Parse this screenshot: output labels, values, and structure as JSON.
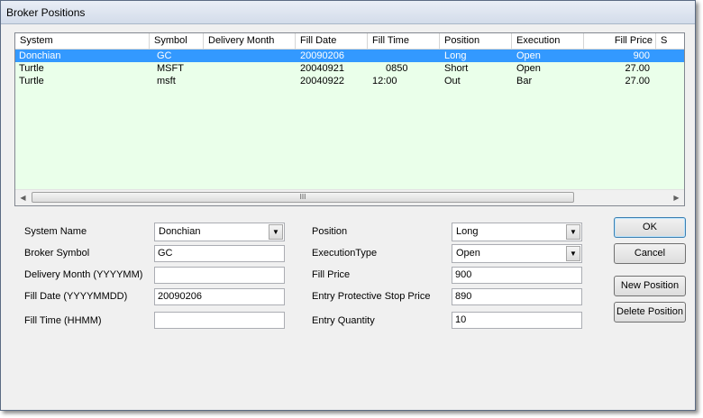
{
  "window": {
    "title": "Broker Positions"
  },
  "list": {
    "columns": [
      "System",
      "Symbol",
      "Delivery Month",
      "Fill Date",
      "Fill Time",
      "Position",
      "Execution",
      "Fill Price",
      "S"
    ],
    "rows": [
      [
        "Donchian",
        "GC",
        "",
        "20090206",
        "",
        "Long",
        "Open",
        "900"
      ],
      [
        "Turtle",
        "MSFT",
        "",
        "20040921",
        "0850",
        "Short",
        "Open",
        "27.00"
      ],
      [
        "Turtle",
        "msft",
        "",
        "20040922",
        "12:00",
        "Out",
        "Bar",
        "27.00"
      ]
    ],
    "selected_row": 0,
    "scroll_thumb_glyph": "III",
    "scroll_left_icon": "scroll-left-arrow",
    "scroll_right_icon": "scroll-right-arrow"
  },
  "form": {
    "system_name": {
      "label": "System Name",
      "value": "Donchian"
    },
    "broker_symbol": {
      "label": "Broker Symbol",
      "value": "GC"
    },
    "delivery_month": {
      "label": "Delivery Month (YYYYMM)",
      "value": ""
    },
    "fill_date": {
      "label": "Fill Date (YYYYMMDD)",
      "value": "20090206"
    },
    "fill_time": {
      "label": "Fill Time (HHMM)",
      "value": ""
    },
    "position": {
      "label": "Position",
      "value": "Long"
    },
    "execution_type": {
      "label": "ExecutionType",
      "value": "Open"
    },
    "fill_price": {
      "label": "Fill Price",
      "value": "900"
    },
    "entry_stop": {
      "label": "Entry Protective Stop Price",
      "value": "890"
    },
    "entry_qty": {
      "label": "Entry Quantity",
      "value": "10"
    }
  },
  "buttons": {
    "ok": "OK",
    "cancel": "Cancel",
    "new_position": "New Position",
    "delete_position": "Delete Position"
  },
  "colors": {
    "list_bg": "#eaffea",
    "selection": "#3399ff"
  }
}
